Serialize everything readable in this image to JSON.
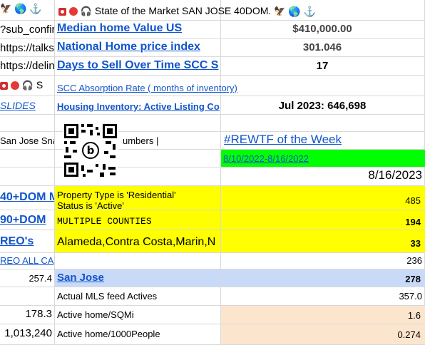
{
  "col_a": {
    "r1_icons": [
      "bird-icon",
      "globe-icon",
      "anchor-icon"
    ],
    "r2": "?sub_confirm",
    "r3": "https://talks",
    "r4": "https://delin",
    "r5_suffix": "S",
    "r6": "SLIDES",
    "r8": "San Jose Snap",
    "r10": "40+DOM M",
    "r11": "90+DOM",
    "r12": "REO's",
    "r13": "REO ALL CA",
    "r14": "257.4",
    "r16": "178.3",
    "r17": "1,013,240"
  },
  "header": {
    "title": "State of the Market SAN JOSE 40DOM.",
    "icons_left": [
      "red-app-icon",
      "red-dot-icon",
      "headphones-icon"
    ],
    "icons_right": [
      "bird-icon",
      "globe-icon",
      "anchor-icon"
    ]
  },
  "col_b": {
    "median_home_value": "Median home Value US",
    "national_price_index": "National Home price index",
    "days_to_sell": "Days to Sell Over Time SCC S",
    "absorption_rate": "SCC Absorption Rate ( months of inventory)",
    "housing_inventory": "Housing Inventory: Active Listing Cou",
    "numbers_suffix": "umbers |",
    "property_type": "Property Type is 'Residential'",
    "status_active": "Status is 'Active'",
    "multiple_counties": "MULTIPLE COUNTIES",
    "counties_list": "Alameda,Contra Costa,Marin,N",
    "san_jose": "San Jose",
    "mls_actives_label": "Actual MLS feed Actives",
    "active_sqmi_label": "Active home/SQMi",
    "active_1000_label": "Active home/1000People"
  },
  "col_c": {
    "median_value": "$410,000.00",
    "price_index_value": "301.046",
    "days_value": "17",
    "inventory_value": "Jul 2023: 646,698",
    "rewtf": "#REWTF of the Week",
    "date_range": "8/10/2022-8/16/2022",
    "date": "8/16/2023",
    "v485": "485",
    "v194": "194",
    "v33": "33",
    "v236": "236",
    "v278": "278",
    "v357": "357.0",
    "v16": "1.6",
    "v0274": "0.274"
  }
}
